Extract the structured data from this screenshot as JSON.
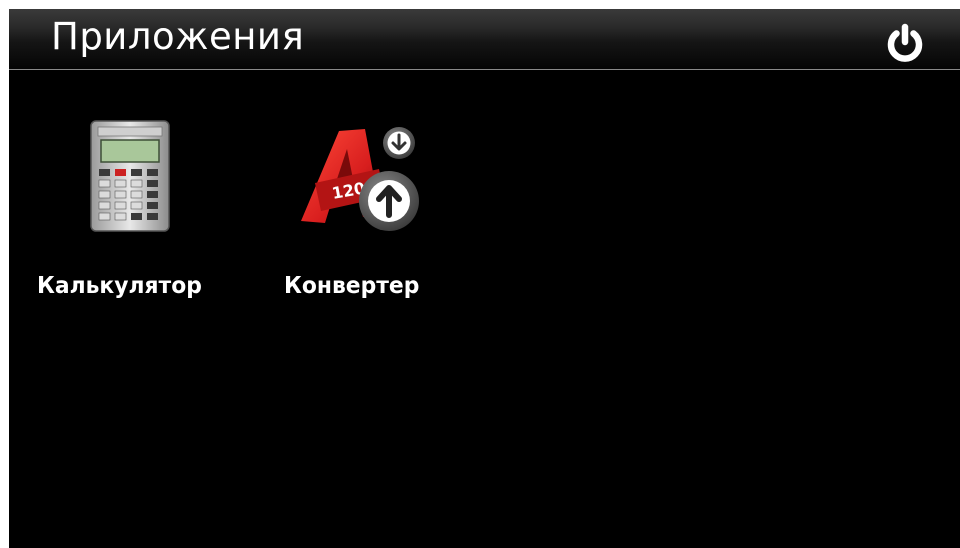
{
  "header": {
    "title": "Приложения",
    "power_icon": "power-icon"
  },
  "apps": [
    {
      "label": "Калькулятор",
      "icon": "calculator-icon"
    },
    {
      "label": "Конвертер",
      "icon": "converter-icon"
    }
  ],
  "colors": {
    "background": "#000000",
    "text": "#ffffff",
    "converter_red": "#d81e1e"
  }
}
